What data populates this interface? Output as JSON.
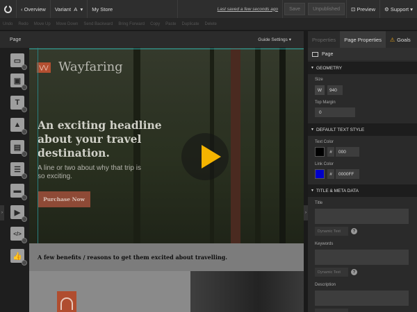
{
  "topbar": {
    "back_label": "Overview",
    "variant_label": "Variant",
    "variant_value": "A",
    "store_name": "My Store",
    "saved_status": "Last saved a few seconds ago",
    "save_label": "Save",
    "unpublished_label": "Unpublished",
    "preview_label": "Preview",
    "support_label": "Support"
  },
  "toolbar": {
    "items": [
      "Undo",
      "Redo",
      "Move Up",
      "Move Down",
      "Send Backward",
      "Bring Forward",
      "Copy",
      "Paste",
      "Duplicate",
      "Delete"
    ]
  },
  "left_panel": {
    "title": "Page",
    "tools": [
      "section-tool",
      "box-tool",
      "text-tool",
      "image-tool",
      "form-tool",
      "list-tool",
      "button-tool",
      "video-tool",
      "html-tool",
      "social-tool"
    ]
  },
  "canvas": {
    "guide_settings_label": "Guide Settings",
    "brand_logo_glyph": "⋁⋁",
    "brand_name": "Wayfaring",
    "headline": "An exciting headline about your travel destination.",
    "subtext": "A line or two about why that trip is so exciting.",
    "cta_label": "Purchase Now",
    "benefits_text": "A few benefits / reasons to get them excited about travelling."
  },
  "right_panel": {
    "tabs": [
      "Properties",
      "Page Properties",
      "Goals"
    ],
    "active_tab": "Page Properties",
    "page_label": "Page",
    "sections": {
      "geometry": "GEOMETRY",
      "default_text_style": "DEFAULT TEXT STYLE",
      "title_meta": "TITLE & META DATA"
    },
    "size_label": "Size",
    "width_prefix": "W",
    "width_value": "940",
    "top_margin_label": "Top Margin",
    "top_margin_value": "0",
    "text_color_label": "Text Color",
    "text_color_value": "000",
    "text_color_swatch": "#000000",
    "link_color_label": "Link Color",
    "link_color_value": "0000FF",
    "link_color_swatch": "#0000c8",
    "title_label": "Title",
    "keywords_label": "Keywords",
    "description_label": "Description",
    "dynamic_text_label": "Dynamic Text",
    "help_glyph": "?",
    "hash": "#"
  },
  "colors": {
    "accent": "#f5b400",
    "brand_orange": "#b34f31",
    "warn": "#e8a317"
  }
}
